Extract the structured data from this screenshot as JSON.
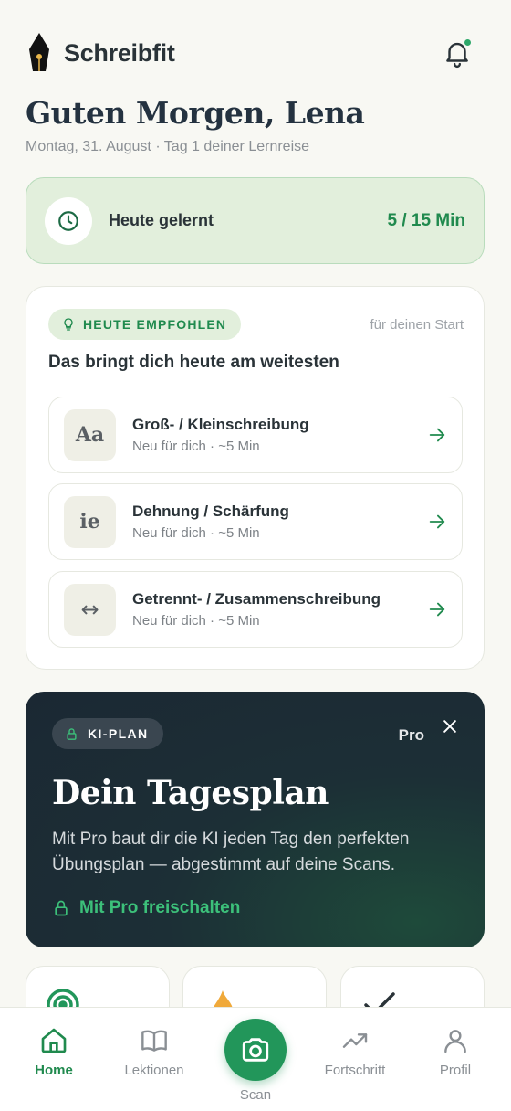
{
  "app": {
    "name": "Schreibfit"
  },
  "greeting": {
    "title": "Guten Morgen, Lena",
    "subtitle": "Montag, 31. August · Tag 1 deiner Lernreise"
  },
  "today": {
    "label": "Heute gelernt",
    "value": "5 / 15 Min",
    "progress_fraction": 0.333
  },
  "recommended": {
    "badge": "HEUTE EMPFOHLEN",
    "note": "für deinen Start",
    "title": "Das bringt dich heute am weitesten",
    "lessons": [
      {
        "icon_text": "Aa",
        "title": "Groß- / Kleinschreibung",
        "subtitle": "Neu für dich · ~5 Min"
      },
      {
        "icon_text": "ie",
        "title": "Dehnung / Schärfung",
        "subtitle": "Neu für dich · ~5 Min"
      },
      {
        "icon_text": "↔",
        "title": "Getrennt- / Zusammenschreibung",
        "subtitle": "Neu für dich · ~5 Min"
      }
    ]
  },
  "plan": {
    "badge": "KI-PLAN",
    "pro": "Pro",
    "title": "Dein Tagesplan",
    "text": "Mit Pro baut dir die KI jeden Tag den perfekten Übungsplan — abgestimmt auf deine Scans.",
    "cta": "Mit Pro freischalten"
  },
  "nav": {
    "home": "Home",
    "lessons": "Lektionen",
    "scan": "Scan",
    "progress": "Fortschritt",
    "profile": "Profil"
  },
  "colors": {
    "accent": "#208a4e",
    "dark_card": "#1b2833",
    "background": "#f8f8f3"
  }
}
